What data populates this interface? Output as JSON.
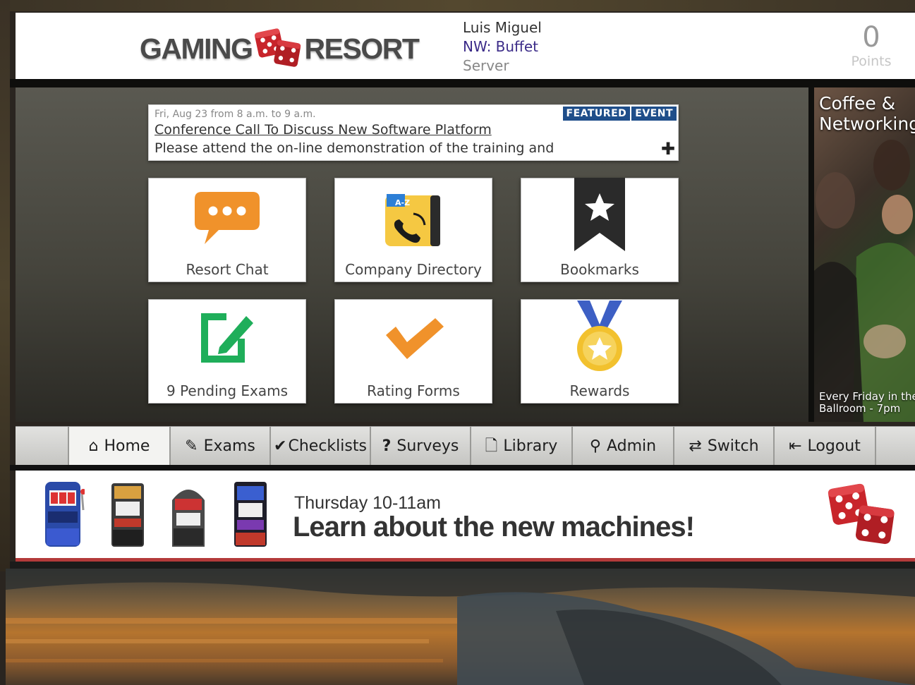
{
  "header": {
    "logo_left": "GAMING",
    "logo_right": "RESORT",
    "user_name": "Luis Miguel",
    "user_location": "NW: Buffet",
    "user_role": "Server",
    "points_value": "0",
    "points_label": "Points"
  },
  "event": {
    "date": "Fri, Aug 23 from 8 a.m. to 9 a.m.",
    "badges": [
      "FEATURED",
      "EVENT"
    ],
    "title": "Conference Call To Discuss New Software Platform",
    "description": "Please attend the on-line demonstration of the training and",
    "expand_symbol": "✚"
  },
  "tiles": [
    {
      "label": "Resort Chat",
      "icon": "chat-bubble-icon"
    },
    {
      "label": "Company Directory",
      "icon": "phone-directory-icon",
      "icon_badge": "A-Z"
    },
    {
      "label": "Bookmarks",
      "icon": "bookmark-star-icon"
    },
    {
      "label": "9 Pending Exams",
      "icon": "edit-pencil-icon"
    },
    {
      "label": "Rating Forms",
      "icon": "checkmark-icon"
    },
    {
      "label": "Rewards",
      "icon": "medal-icon"
    }
  ],
  "promo": {
    "title_line1": "Coffee &",
    "title_line2": "Networking",
    "caption_line1": "Every Friday in the",
    "caption_line2": "Ballroom - 7pm"
  },
  "nav": {
    "items": [
      {
        "label": "Home",
        "icon": "home-icon",
        "glyph": "⌂"
      },
      {
        "label": "Exams",
        "icon": "edit-icon",
        "glyph": "✎"
      },
      {
        "label": "Checklists",
        "icon": "check-icon",
        "glyph": "✔"
      },
      {
        "label": "Surveys",
        "icon": "question-icon",
        "glyph": "?"
      },
      {
        "label": "Library",
        "icon": "document-icon",
        "glyph": "🗋"
      },
      {
        "label": "Admin",
        "icon": "key-icon",
        "glyph": "⚲"
      },
      {
        "label": "Switch",
        "icon": "swap-icon",
        "glyph": "⇄"
      },
      {
        "label": "Logout",
        "icon": "logout-icon",
        "glyph": "⇤"
      }
    ]
  },
  "banner": {
    "subtitle": "Thursday 10-11am",
    "headline": "Learn about the new machines!"
  },
  "colors": {
    "accent_blue": "#1f4e8a",
    "chat_orange": "#f0922b",
    "directory_yellow": "#f5c842",
    "exam_green": "#1fae5a",
    "dice_red": "#c8252b",
    "user_location_purple": "#3b2b88"
  }
}
